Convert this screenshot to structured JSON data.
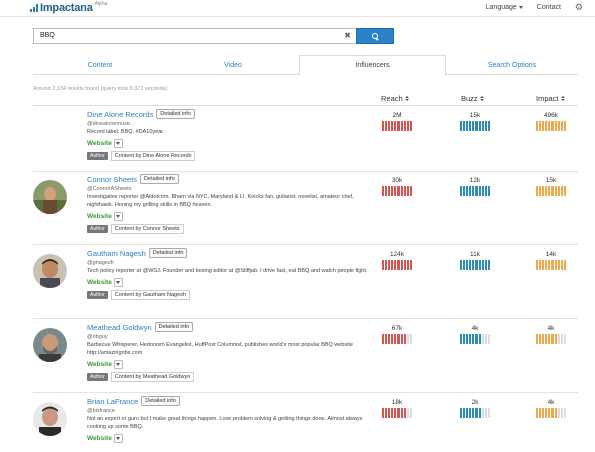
{
  "app": {
    "name": "Impactana",
    "badge": "Alpha"
  },
  "nav": {
    "language": "Language",
    "contact": "Contact",
    "settings_icon": "gear-icon"
  },
  "search": {
    "value": "BBQ",
    "clear_icon": "close-icon",
    "button_icon": "search-icon"
  },
  "tabs": [
    {
      "label": "Content",
      "active": false
    },
    {
      "label": "Video",
      "active": false
    },
    {
      "label": "Influencers",
      "active": true
    },
    {
      "label": "Search Options",
      "active": false
    }
  ],
  "results_info": "Around 2,134 results found (query took 0.371 seconds)",
  "columns": {
    "reach": "Reach",
    "buzz": "Buzz",
    "impact": "Impact"
  },
  "colors": {
    "reach": "#d9534f",
    "buzz": "#2e8bb8",
    "impact": "#f0a848",
    "empty": "#dcdcdc",
    "link": "#2b82c9",
    "website": "#3a9a3a"
  },
  "rows": [
    {
      "name": "Dine Alone Records",
      "detail": "Detailed info",
      "handle": "@dinealonemusic",
      "bio": "Record label. BBQ. #DA10year.",
      "website": "Website",
      "author": "Author",
      "content_by": "Content by Dine Alone Records",
      "reach": {
        "value": "2M",
        "filled": 10
      },
      "buzz": {
        "value": "15k",
        "filled": 10
      },
      "impact": {
        "value": "496k",
        "filled": 10
      }
    },
    {
      "name": "Connor Sheets",
      "detail": "Detailed info",
      "handle": "@ConnorASheets",
      "bio": "Investigative reporter @Aldotcom. Bham via NYC, Maryland & LI. Knicks fan, guitarist, novelist, amateur chef, nighthawk. Honing my grilling skills in BBQ heaven.",
      "website": "Website",
      "author": "Author",
      "content_by": "Content by Connor Sheets",
      "reach": {
        "value": "30k",
        "filled": 10
      },
      "buzz": {
        "value": "12k",
        "filled": 10
      },
      "impact": {
        "value": "15k",
        "filled": 10
      }
    },
    {
      "name": "Gautham Nagesh",
      "detail": "Detailed info",
      "handle": "@gnagesh",
      "bio": "Tech policy reporter at @WSJ. Founder and boxing editor at @Stiffjab. I drive fast, eat BBQ and watch people fight.",
      "website": "Website",
      "author": "Author",
      "content_by": "Content by Gautham Nagesh",
      "reach": {
        "value": "124k",
        "filled": 10
      },
      "buzz": {
        "value": "11k",
        "filled": 10
      },
      "impact": {
        "value": "14k",
        "filled": 10
      }
    },
    {
      "name": "Meathead Goldwyn",
      "detail": "Detailed info",
      "handle": "@ribguy",
      "bio": "Barbecue Whisperer, Hedonism Evangelist, HuffPost Columnist, publishes world's most popular BBQ website http://amazingribs.com",
      "website": "Website",
      "author": "Author",
      "content_by": "Content by Meathead Goldwyn",
      "reach": {
        "value": "67k",
        "filled": 8
      },
      "buzz": {
        "value": "4k",
        "filled": 7
      },
      "impact": {
        "value": "4k",
        "filled": 7
      }
    },
    {
      "name": "Brian LaFrance",
      "detail": "Detailed info",
      "handle": "@bixfrance",
      "bio": "Not an expert or guru but I make great things happen. Love problem solving & getting things done. Almost always cooking up some BBQ.",
      "website": "Website",
      "author": "Author",
      "content_by": "",
      "reach": {
        "value": "18k",
        "filled": 8
      },
      "buzz": {
        "value": "2k",
        "filled": 7
      },
      "impact": {
        "value": "4k",
        "filled": 7
      }
    }
  ]
}
